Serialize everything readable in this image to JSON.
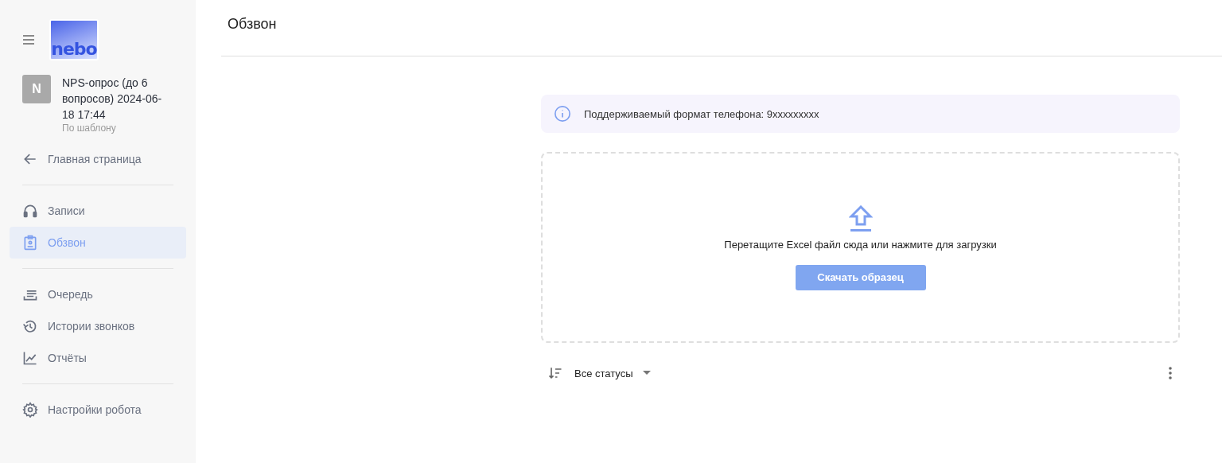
{
  "sidebar": {
    "logo": "nebo",
    "project": {
      "avatar": "N",
      "name": "NPS-опрос (до 6 вопросов) 2024-06-18 17:44",
      "subtitle": "По шаблону"
    },
    "nav_groups": [
      [
        {
          "kind": "back",
          "label": "Главная страница",
          "selected": false
        }
      ],
      [
        {
          "kind": "headphones",
          "label": "Записи",
          "selected": false
        },
        {
          "kind": "clipboard",
          "label": "Обзвон",
          "selected": true
        }
      ],
      [
        {
          "kind": "queue",
          "label": "Очередь",
          "selected": false
        },
        {
          "kind": "history",
          "label": "Истории звонков",
          "selected": false
        },
        {
          "kind": "chart",
          "label": "Отчёты",
          "selected": false
        }
      ],
      [
        {
          "kind": "settings",
          "label": "Настройки робота",
          "selected": false
        }
      ]
    ]
  },
  "header": {
    "title": "Обзвон"
  },
  "info": {
    "text": "Поддерживаемый формат телефона: 9xxxxxxxxx"
  },
  "dropzone": {
    "text": "Перетащите Excel файл сюда или нажмите для загрузки",
    "button": "Скачать образец"
  },
  "filter": {
    "value": "Все статусы"
  }
}
